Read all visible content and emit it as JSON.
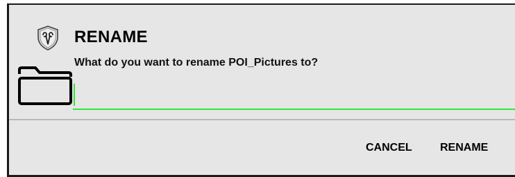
{
  "dialog": {
    "title": "RENAME",
    "prompt": "What do you want to rename POI_Pictures to?",
    "input_value": "",
    "app_icon": "ram-shield-icon",
    "folder_icon": "folder-icon"
  },
  "actions": {
    "cancel_label": "CANCEL",
    "rename_label": "RENAME"
  },
  "colors": {
    "accent": "#2ee836",
    "dialog_background": "#e6e6e6"
  }
}
